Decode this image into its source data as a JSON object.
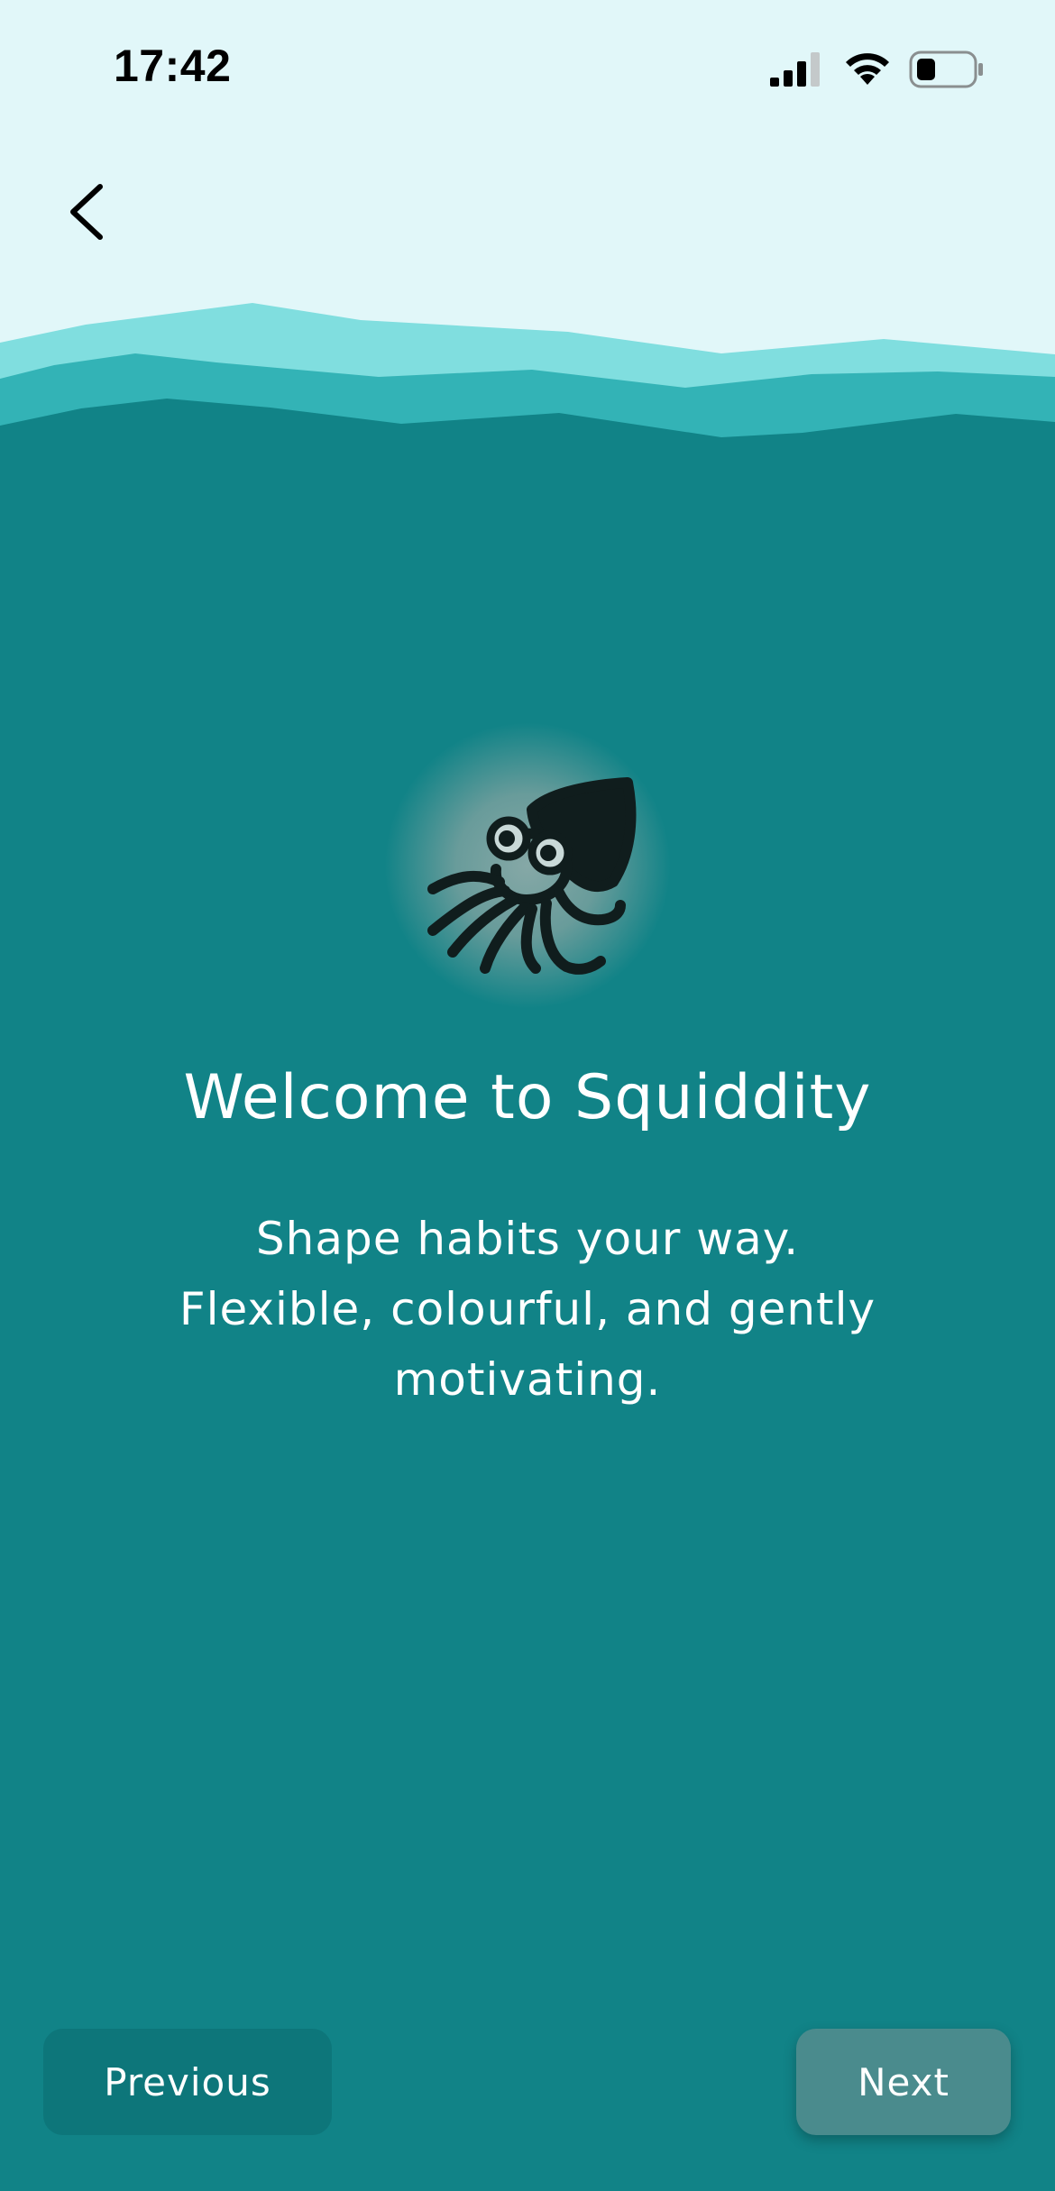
{
  "status_bar": {
    "time": "17:42",
    "icons": [
      "signal-icon",
      "wifi-icon",
      "battery-icon"
    ]
  },
  "header": {
    "back_icon": "chevron-left-icon"
  },
  "onboarding": {
    "hero_icon": "squid-icon",
    "title": "Welcome to Squiddity",
    "subtitle": "Shape habits your way.\nFlexible, colourful, and gently\nmotivating."
  },
  "footer": {
    "previous_label": "Previous",
    "next_label": "Next"
  },
  "colors": {
    "sky": "#e1f7f9",
    "wave_light": "#80dedf",
    "wave_mid": "#33b3b6",
    "ocean": "#118387",
    "previous_button": "#0d767a",
    "next_button": "#4a8b8d",
    "text": "#ffffff"
  }
}
